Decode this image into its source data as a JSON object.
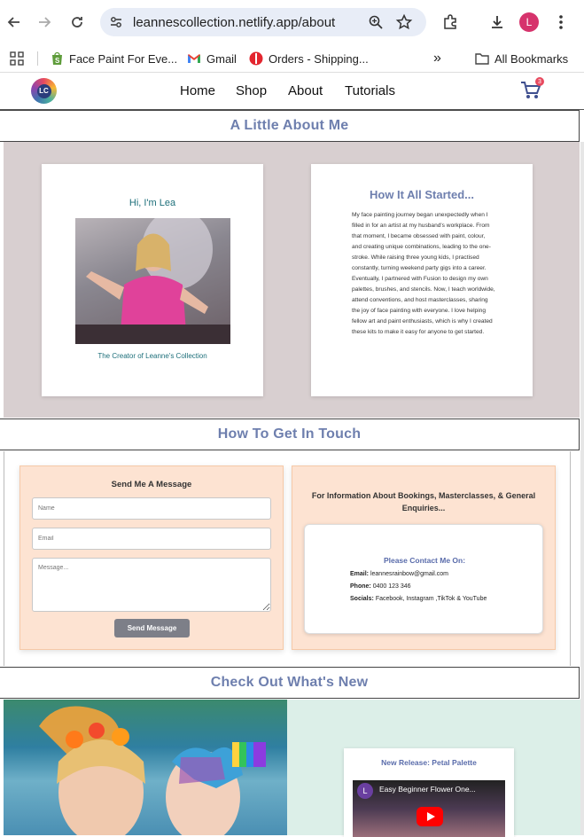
{
  "browser": {
    "url": "leannescollection.netlify.app/about",
    "profile_initial": "L",
    "bookmarks": [
      {
        "label": "Face Paint For Eve..."
      },
      {
        "label": "Gmail"
      },
      {
        "label": "Orders - Shipping..."
      }
    ],
    "all_bookmarks": "All Bookmarks",
    "overflow": "»"
  },
  "site": {
    "logo_text": "LC",
    "menu": [
      "Home",
      "Shop",
      "About",
      "Tutorials"
    ],
    "cart_count": "3"
  },
  "about": {
    "heading": "A Little About Me",
    "greeting": "Hi, I'm Lea",
    "caption": "The Creator of Leanne's Collection",
    "story_title": "How It All Started...",
    "story": "My face painting journey began unexpectedly when I filled in for an artist at my husband's workplace. From that moment, I became obsessed with paint, colour, and creating unique combinations, leading to the one-stroke. While raising three young kids, I practised constantly, turning weekend party gigs into a career. Eventually, I partnered with Fusion to design my own palettes, brushes, and stencils. Now, I teach worldwide, attend conventions, and host masterclasses, sharing the joy of face painting with everyone. I love helping fellow art and paint enthusiasts, which is why I created these kits to make it easy for anyone to get started."
  },
  "contact": {
    "heading": "How To Get In Touch",
    "form_title": "Send Me A Message",
    "name_placeholder": "Name",
    "email_placeholder": "Email",
    "message_placeholder": "Message...",
    "send_label": "Send Message",
    "info_title": "For Information About Bookings, Masterclasses, & General Enquiries...",
    "contact_on": "Please Contact Me On:",
    "email_label": "Email:",
    "email_value": "leannesrainbow@gmail.com",
    "phone_label": "Phone:",
    "phone_value": "0400 123 346",
    "socials_label": "Socials:",
    "socials_value": "Facebook, Instagram ,TikTok & YouTube"
  },
  "news": {
    "heading": "Check Out What's New",
    "release_title": "New Release: Petal Palette",
    "video_title": "Easy Beginner Flower One...",
    "video_channel_initial": "L"
  }
}
